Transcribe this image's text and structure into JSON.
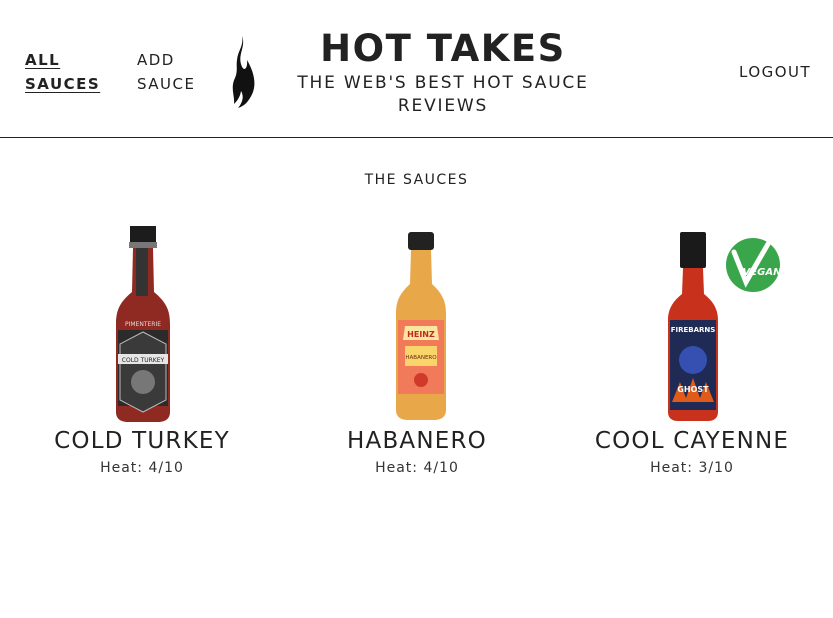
{
  "nav": {
    "all_sauces": "ALL SAUCES",
    "add_sauce": "ADD SAUCE",
    "logout": "LOGOUT"
  },
  "brand": {
    "title": "HOT TAKES",
    "subtitle": "THE WEB'S BEST HOT SAUCE REVIEWS",
    "logo_icon": "flame-icon"
  },
  "section_title": "THE SAUCES",
  "sauces": [
    {
      "name": "COLD TURKEY",
      "heat": "Heat: 4/10",
      "bottle_label": "COLD TURKEY",
      "brand_label": "PIMENTERIE",
      "label_color": "#2b2b2b"
    },
    {
      "name": "HABANERO",
      "heat": "Heat: 4/10",
      "bottle_label": "HABANERO",
      "brand_label": "HEINZ",
      "label_color": "#f07a5a"
    },
    {
      "name": "COOL CAYENNE",
      "heat": "Heat: 3/10",
      "bottle_label": "GHOST",
      "brand_label": "FIREBARNS",
      "label_color": "#1f2a55",
      "badge": "VEGAN"
    }
  ],
  "colors": {
    "text": "#222222",
    "divider": "#222222",
    "vegan_badge": "#3aa64c"
  }
}
